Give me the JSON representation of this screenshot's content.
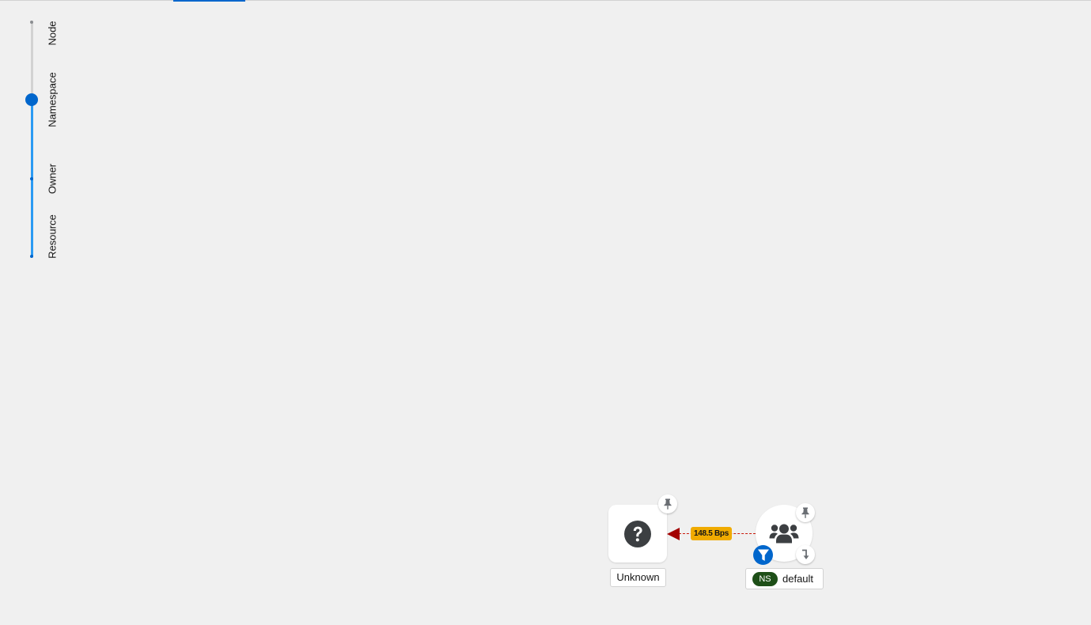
{
  "tabs": {
    "active_indicator": "active-tab"
  },
  "scope_slider": {
    "current_value": "Namespace",
    "levels": [
      {
        "label": "Node"
      },
      {
        "label": "Namespace"
      },
      {
        "label": "Owner"
      },
      {
        "label": "Resource"
      }
    ],
    "colors": {
      "active_track": "#2b9af3",
      "inactive_track": "#d2d2d2",
      "thumb": "#0066cc"
    }
  },
  "topology": {
    "nodes": [
      {
        "id": "unknown",
        "label": "Unknown",
        "icon": "question-circle-icon",
        "shape": "rounded-square",
        "pinned_icon": "thumbtack-icon"
      },
      {
        "id": "default",
        "label": "default",
        "kind_badge": "NS",
        "icon": "users-icon",
        "shape": "circle",
        "pinned_icon": "thumbtack-icon",
        "filter_icon": "filter-icon",
        "step_into_icon": "level-down-icon"
      }
    ],
    "edges": [
      {
        "from": "default",
        "to": "unknown",
        "tag": "148.5 Bps",
        "style": "dashed",
        "color": "#c9190b",
        "tag_color": "#f0ab00"
      }
    ]
  },
  "colors": {
    "background": "#f0f0f0",
    "accent": "#0066cc",
    "ns_badge": "#1e4f18"
  }
}
